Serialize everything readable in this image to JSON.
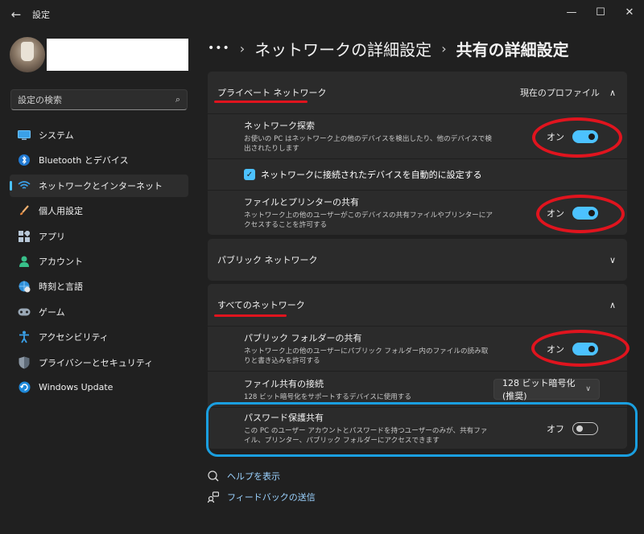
{
  "window": {
    "title": "設定",
    "back_icon": "←",
    "minimize_icon": "—",
    "maximize_icon": "☐",
    "close_icon": "✕"
  },
  "search": {
    "placeholder": "設定の検索",
    "icon": "⌕"
  },
  "sidebar": {
    "items": [
      {
        "label": "システム",
        "icon": "monitor",
        "active": false
      },
      {
        "label": "Bluetooth とデバイス",
        "icon": "bluetooth",
        "active": false
      },
      {
        "label": "ネットワークとインターネット",
        "icon": "wifi",
        "active": true
      },
      {
        "label": "個人用設定",
        "icon": "brush",
        "active": false
      },
      {
        "label": "アプリ",
        "icon": "apps",
        "active": false
      },
      {
        "label": "アカウント",
        "icon": "person",
        "active": false
      },
      {
        "label": "時刻と言語",
        "icon": "globe-clock",
        "active": false
      },
      {
        "label": "ゲーム",
        "icon": "gamepad",
        "active": false
      },
      {
        "label": "アクセシビリティ",
        "icon": "accessibility",
        "active": false
      },
      {
        "label": "プライバシーとセキュリティ",
        "icon": "shield",
        "active": false
      },
      {
        "label": "Windows Update",
        "icon": "update",
        "active": false
      }
    ]
  },
  "breadcrumb": {
    "more": "•••",
    "sep": "›",
    "parent": "ネットワークの詳細設定",
    "current": "共有の詳細設定"
  },
  "private_network": {
    "title": "プライベート ネットワーク",
    "badge": "現在のプロファイル",
    "chevron": "∧",
    "discovery": {
      "title": "ネットワーク探索",
      "desc": "お使いの PC はネットワーク上の他のデバイスを検出したり、他のデバイスで検出されたりします",
      "state": "オン"
    },
    "auto_setup": {
      "label": "ネットワークに接続されたデバイスを自動的に設定する",
      "check": "✓"
    },
    "file_printer": {
      "title": "ファイルとプリンターの共有",
      "desc": "ネットワーク上の他のユーザーがこのデバイスの共有ファイルやプリンターにアクセスすることを許可する",
      "state": "オン"
    }
  },
  "public_network": {
    "title": "パブリック ネットワーク",
    "chevron": "∨"
  },
  "all_networks": {
    "title": "すべてのネットワーク",
    "chevron": "∧",
    "public_folder": {
      "title": "パブリック フォルダーの共有",
      "desc": "ネットワーク上の他のユーザーにパブリック フォルダー内のファイルの読み取りと書き込みを許可する",
      "state": "オン"
    },
    "file_sharing": {
      "title": "ファイル共有の接続",
      "desc": "128 ビット暗号化をサポートするデバイスに使用する",
      "value": "128 ビット暗号化 (推奨)",
      "arrow": "∨"
    },
    "password": {
      "title": "パスワード保護共有",
      "desc": "この PC のユーザー アカウントとパスワードを持つユーザーのみが、共有ファイル、プリンター、パブリック フォルダーにアクセスできます",
      "state": "オフ"
    }
  },
  "links": {
    "help": "ヘルプを表示",
    "feedback": "フィードバックの送信"
  },
  "colors": {
    "accent": "#4cc2ff",
    "annotation_red": "#e0141e",
    "annotation_blue": "#1a9fe0"
  }
}
